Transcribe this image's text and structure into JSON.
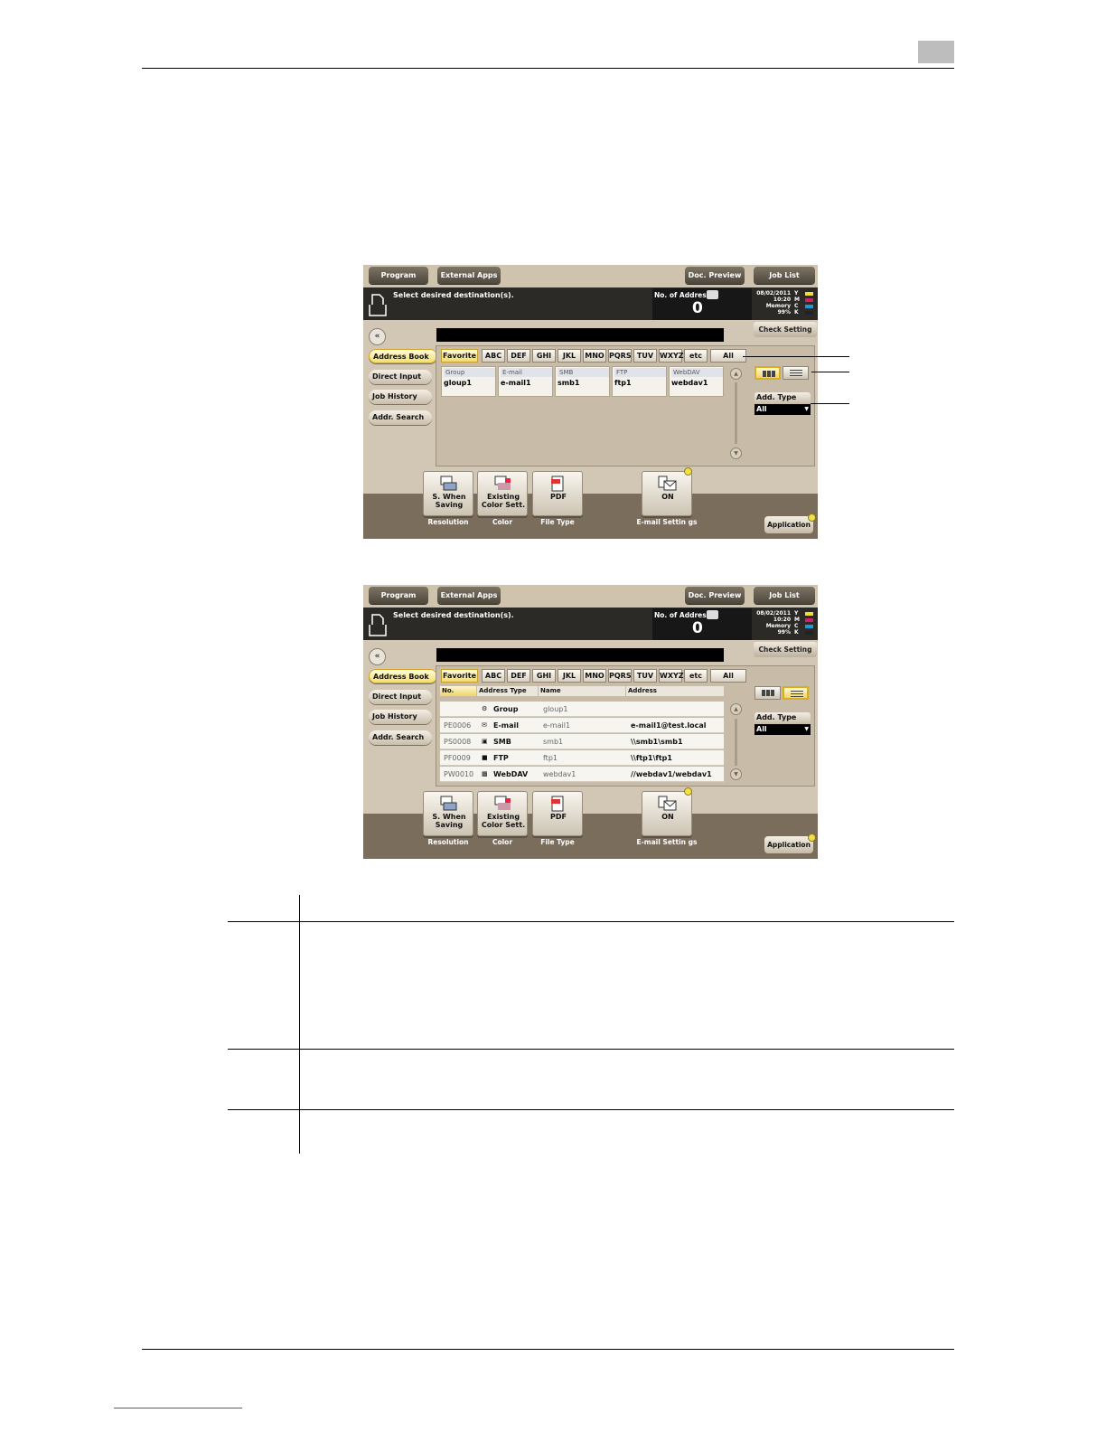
{
  "screen_top": {
    "buttons": [
      "Program",
      "External Apps",
      "Doc. Preview",
      "Job List"
    ],
    "message": "Select desired destination(s).",
    "address_count_label": "No. of Address",
    "address_count": "0",
    "date": "08/02/2011",
    "time": "10:20",
    "memory_label": "Memory",
    "memory_value": "99%",
    "toner_labels": [
      "Y",
      "M",
      "C",
      "K"
    ],
    "toner_colors": [
      "#f2df2c",
      "#d21e6e",
      "#1e9ad6",
      "#222222"
    ],
    "check_setting": "Check Setting"
  },
  "side_tabs": [
    "Address Book",
    "Direct Input",
    "Job History",
    "Addr. Search"
  ],
  "index_tabs": [
    "Favorite",
    "ABC",
    "DEF",
    "GHI",
    "JKL",
    "MNO",
    "PQRS",
    "TUV",
    "WXYZ",
    "etc",
    "All"
  ],
  "add_type": {
    "label": "Add. Type",
    "value": "All"
  },
  "cards": [
    {
      "type": "Group",
      "name": "gloup1"
    },
    {
      "type": "E-mail",
      "name": "e-mail1"
    },
    {
      "type": "SMB",
      "name": "smb1"
    },
    {
      "type": "FTP",
      "name": "ftp1"
    },
    {
      "type": "WebDAV",
      "name": "webdav1"
    }
  ],
  "list_headers": [
    "No.",
    "Address Type",
    "Name",
    "Address"
  ],
  "list_rows": [
    {
      "no": "",
      "type": "Group",
      "name": "gloup1",
      "address": ""
    },
    {
      "no": "PE0006",
      "type": "E-mail",
      "name": "e-mail1",
      "address": "e-mail1@test.local"
    },
    {
      "no": "PS0008",
      "type": "SMB",
      "name": "smb1",
      "address": "\\\\smb1\\smb1"
    },
    {
      "no": "PF0009",
      "type": "FTP",
      "name": "ftp1",
      "address": "\\\\ftp1\\ftp1"
    },
    {
      "no": "PW0010",
      "type": "WebDAV",
      "name": "webdav1",
      "address": "//webdav1/webdav1"
    }
  ],
  "func_buttons": [
    {
      "value": "S. When Saving",
      "label": "Resolution"
    },
    {
      "value": "Existing Color Sett.",
      "label": "Color"
    },
    {
      "value": "PDF",
      "label": "File Type"
    },
    {
      "value": "ON",
      "label": "E-mail Settin gs"
    }
  ],
  "application": "Application"
}
